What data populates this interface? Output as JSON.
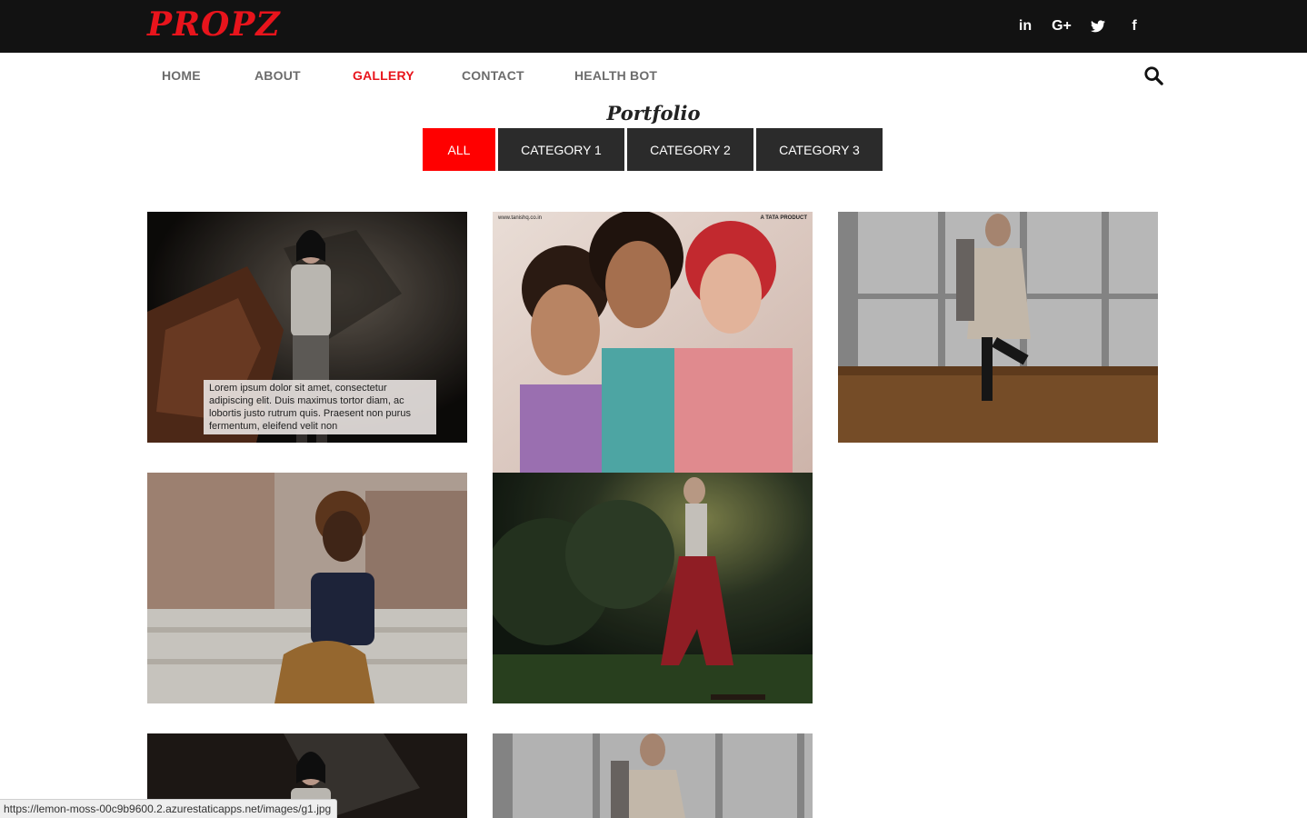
{
  "brand": {
    "logo": "PROPZ",
    "accent_color": "#e8141c"
  },
  "social": [
    {
      "name": "linkedin-icon",
      "glyph": "in"
    },
    {
      "name": "google-plus-icon",
      "glyph": "G+"
    },
    {
      "name": "twitter-icon",
      "glyph": ""
    },
    {
      "name": "facebook-icon",
      "glyph": "f"
    }
  ],
  "nav": {
    "items": [
      {
        "label": "HOME"
      },
      {
        "label": "ABOUT"
      },
      {
        "label": "GALLERY",
        "active": true
      },
      {
        "label": "CONTACT"
      },
      {
        "label": "HEALTH BOT"
      }
    ],
    "search_icon": "search-icon"
  },
  "portfolio": {
    "title": "Portfolio",
    "filters": [
      {
        "label": "ALL",
        "active": true
      },
      {
        "label": "CATEGORY 1"
      },
      {
        "label": "CATEGORY 2"
      },
      {
        "label": "CATEGORY 3"
      }
    ]
  },
  "gallery": {
    "caption": "Lorem ipsum dolor sit amet, consectetur adipiscing elit. Duis maximus tortor diam, ac lobortis justo rutrum quis. Praesent non purus fermentum, eleifend velit non",
    "tile2_text_left": "www.tanishq.co.in",
    "tile2_text_right": "A TATA PRODUCT"
  },
  "status_bar": {
    "url": "https://lemon-moss-00c9b9600.2.azurestaticapps.net/images/g1.jpg"
  }
}
